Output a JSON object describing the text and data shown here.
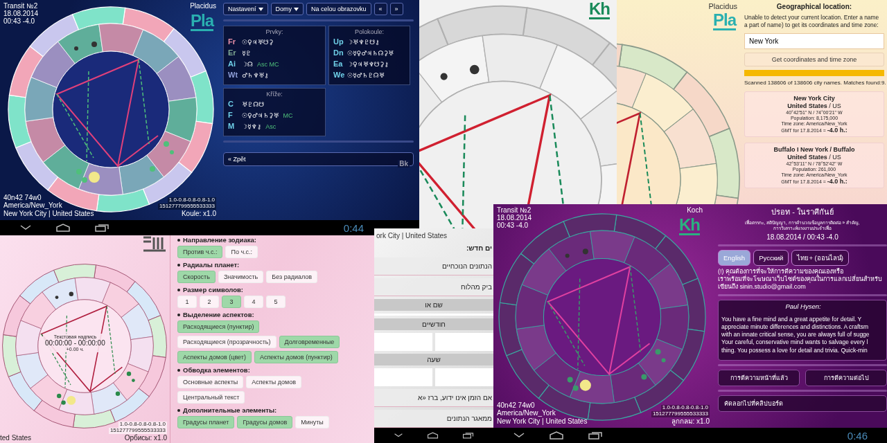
{
  "blue_screen": {
    "title": "Transit №2",
    "date": "18.08.2014",
    "time": "00:43 -4.0",
    "house_system": "Placidus",
    "logo": "Pla",
    "coordinates": "40n42 74w0",
    "timezone": "America/New_York",
    "place": "New York City | United States",
    "orb_row_1": "1.0-0.8-0.8-0.8-1.0",
    "orb_row_2": "151277799555533333",
    "scale": "Koule: x1.0",
    "menu": [
      {
        "label": "Nastavení",
        "dropdown": true
      },
      {
        "label": "Domy",
        "dropdown": true
      },
      {
        "label": "Na celou obrazovku",
        "dropdown": false
      },
      {
        "label": "«",
        "dropdown": false
      },
      {
        "label": "»",
        "dropdown": false
      }
    ],
    "tables": [
      {
        "title": "Prvky:",
        "rows": [
          {
            "label": "Fr",
            "color": "#e890a8",
            "symbols": "☉♀♃♅☋⚳"
          },
          {
            "label": "Er",
            "color": "#7fa893",
            "symbols": "☿♇"
          },
          {
            "label": "Ai",
            "color": "#6fd0e8",
            "symbols": "☽☊",
            "points": "Asc MC"
          },
          {
            "label": "Wt",
            "color": "#8f9fd8",
            "symbols": "♂♄♆♅⚷"
          }
        ]
      },
      {
        "title": "Polokoule:",
        "rows": [
          {
            "label": "Up",
            "color": "#6fd0e8",
            "symbols": "☽♅♆♇☋⚷"
          },
          {
            "label": "Dn",
            "color": "#6fd0e8",
            "symbols": "☉☿♀♂♃♄☊⚳♅"
          },
          {
            "label": "Ea",
            "color": "#6fd0e8",
            "symbols": "☽♀♃♅♆☋⚳⚷"
          },
          {
            "label": "We",
            "color": "#6fd0e8",
            "symbols": "☉☿♂♄♇☊♅"
          }
        ]
      },
      {
        "title": "Kříže:",
        "rows": [
          {
            "label": "C",
            "color": "#6fd0e8",
            "symbols": "♅♇☊☋"
          },
          {
            "label": "F",
            "color": "#6fd0e8",
            "symbols": "☉♀♂♃♄⚳♅",
            "points": "MC"
          },
          {
            "label": "M",
            "color": "#6fd0e8",
            "symbols": "☽☿♆⚷",
            "points": "Asc"
          }
        ]
      }
    ],
    "back_button": {
      "label": "« Zpět",
      "badge": "Bk"
    },
    "clock": "0:44"
  },
  "white_screen": {
    "logo": "Kh"
  },
  "yellow_screen": {
    "house_system": "Placidus",
    "logo": "Pla",
    "heading": "Geographical location:",
    "prompt_lines": [
      "Unable to detect your current location. Enter a name",
      "a part of name) to get its coordinates and time zone:"
    ],
    "search": {
      "value": "New York"
    },
    "button": "Get coordinates and time zone",
    "progress": {
      "level": 1.0
    },
    "status": "Scanned 138606 of 138606 city names. Matches found:9.",
    "results": [
      {
        "city": "New York City",
        "country": "**United States** / US",
        "coords": "40°42'51\" N / 74°00'21\" W",
        "population": "Population: 8,175,000",
        "timezone": "Time zone: America/New_York",
        "gmt_label": "GMT for 17.8.2014 = ",
        "gmt_value": "-4.0 h.:"
      },
      {
        "city": "Buffalo I New York / Buffalo",
        "country": "**United States** / US",
        "coords": "42°53'11\" N / 78°52'42\" W",
        "population": "Population: 261,000",
        "timezone": "Time zone: America/New_York",
        "gmt_label": "GMT for 17.8.2014 = ",
        "gmt_value": "-4.0 h.:"
      }
    ]
  },
  "pink_screen": {
    "chart_caption": "Текстовая надпись",
    "chart_times": "00:00:00 - 00:00:00",
    "chart_offset": "+0.00 ч.",
    "place_fragment": "ted States",
    "scale": "Орбисы: x1.0",
    "orb_row_1": "1.0-0.8-0.8-0.8-1.0",
    "orb_row_2": "151277799555533333",
    "groups": [
      {
        "title": "Направление зодиака:",
        "options": [
          {
            "label": "Против ч.с.:",
            "selected": true
          },
          {
            "label": "По ч.с.:",
            "selected": false
          }
        ]
      },
      {
        "title": "Радиалы планет:",
        "options": [
          {
            "label": "Скорость",
            "selected": true
          },
          {
            "label": "Значимость",
            "selected": false
          },
          {
            "label": "Без радиалов",
            "selected": false
          }
        ]
      },
      {
        "title": "Размер символов:",
        "options": [
          {
            "label": "1",
            "selected": false
          },
          {
            "label": "2",
            "selected": false
          },
          {
            "label": "3",
            "selected": true
          },
          {
            "label": "4",
            "selected": false
          },
          {
            "label": "5",
            "selected": false
          }
        ]
      },
      {
        "title": "Выделение аспектов:",
        "options": [
          {
            "label": "Расходящиеся (пунктир)",
            "selected": true
          },
          {
            "label": "Расходящиеся (прозрачность)",
            "selected": false
          },
          {
            "label": "Долговременные",
            "selected": true
          },
          {
            "label": "Аспекты домов (цвет)",
            "selected": true
          },
          {
            "label": "Аспекты домов (пунктир)",
            "selected": true
          }
        ]
      },
      {
        "title": "Обводка элементов:",
        "options": [
          {
            "label": "Основные аспекты",
            "selected": false
          },
          {
            "label": "Аспекты домов",
            "selected": false
          },
          {
            "label": "Центральный текст",
            "selected": false
          }
        ]
      },
      {
        "title": "Дополнительные элементы:",
        "options": [
          {
            "label": "Градусы планет",
            "selected": true
          },
          {
            "label": "Градусы домов",
            "selected": true
          },
          {
            "label": "Минуты",
            "selected": false
          }
        ]
      }
    ]
  },
  "hebrew_screen": {
    "place_fragment": "ork City | United States",
    "items": [
      {
        "kind": "heading",
        "text": "ים חדש:"
      },
      {
        "kind": "row",
        "text": "הנתונים הנוכחיים"
      },
      {
        "kind": "row",
        "text": "ביק מהלוח"
      },
      {
        "kind": "label",
        "text": "שם או"
      },
      {
        "kind": "field"
      },
      {
        "kind": "label",
        "text": "חודשיים"
      },
      {
        "kind": "pair"
      },
      {
        "kind": "label",
        "text": "שעה"
      },
      {
        "kind": "pair"
      },
      {
        "kind": "row",
        "text": "אם הזמן אינו ידוע, ברז «א"
      },
      {
        "kind": "row",
        "text": "ממאגר הנתונים"
      }
    ]
  },
  "purple_screen": {
    "title": "Transit №2",
    "date": "18.08.2014",
    "time": "00:43 -4.0",
    "house_system": "Koch",
    "logo": "Kh",
    "coordinates": "40n42 74w0",
    "timezone": "America/New_York",
    "place": "New York City | United States",
    "orb_row_1": "1.0-0.8-0.8-0.8-1.0",
    "orb_row_2": "151277799555533333",
    "scale": "ลูกกลม: x1.0",
    "heading": "ปรอท - ในราศีกันย์",
    "subheading_lines": [
      "เพื่อตรรกะ, สติปัญญา, การคำนวณข้อมูลการติดต่อ » สำคัญ,",
      "การวิเคราะห์แรงงานประจำเพื่อ"
    ],
    "datetime": "18.08.2014 / 00:43 -4.0",
    "languages": [
      {
        "label": "English",
        "selected": true
      },
      {
        "label": "Русский",
        "selected": false
      },
      {
        "label": "ไทย+ (ออนไลน์)",
        "selected": false
      }
    ],
    "notice_lines": [
      "(!) คุณต้องการที่จะให้การตีความของคุณเองหรือ",
      "เราพร้อมที่จะโฆษณาเว็บไซต์ของคุณในการแลกเปลี่ยนสำหรับ"
    ],
    "notice_contact": "เขียนถึง sinin.studio@gmail.com",
    "author": "Paul Hysen:",
    "reading_lines": [
      "You have a fine mind and a great appetite for detail. Y",
      "appreciate minute differences and distinctions. A craftsm",
      "with an innate critical sense, you are always full of sugge",
      "Your careful, conservative mind wants to salvage every l",
      "thing. You possess a love for detail and trivia. Quick-min"
    ],
    "buttons": [
      "การตีความหน้าที่แล้ว",
      "การตีความต่อไป"
    ],
    "copy_button": "คัดลอกไปที่คลิปบอร์ด",
    "clock": "0:46"
  }
}
